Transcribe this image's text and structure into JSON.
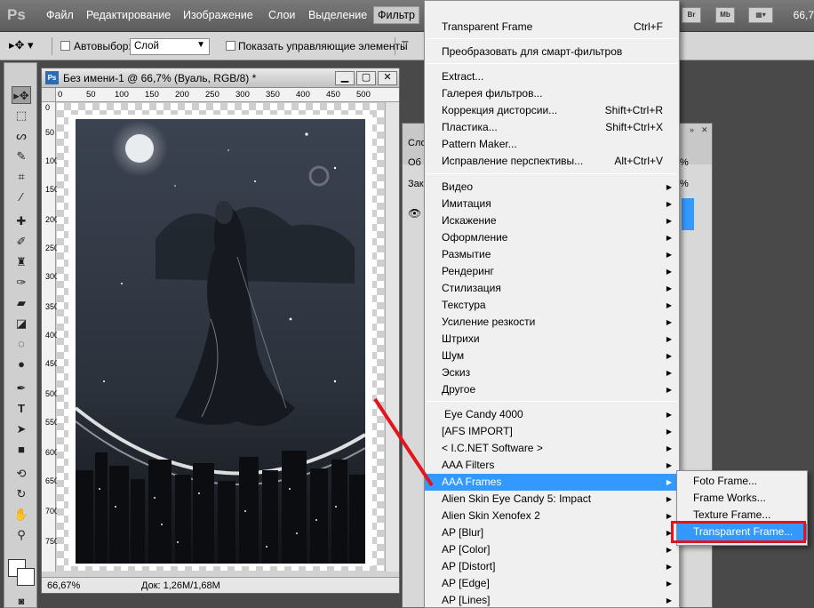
{
  "app": {
    "logo": "Ps",
    "zoom_top": "66,7"
  },
  "menubar": {
    "items": [
      "Файл",
      "Редактирование",
      "Изображение",
      "Слои",
      "Выделение",
      "Фильтр"
    ],
    "right_icons": [
      "Br",
      "Mb"
    ]
  },
  "options": {
    "autoselect_label": "Автовыбор:",
    "layer_value": "Слой",
    "show_controls_label": "Показать управляющие элементы"
  },
  "document": {
    "title": "Без имени-1 @ 66,7% (Вуаль, RGB/8) *",
    "ruler_h": [
      "0",
      "50",
      "100",
      "150",
      "200",
      "250",
      "300",
      "350",
      "400",
      "450",
      "500"
    ],
    "ruler_v": [
      "0",
      "50",
      "100",
      "150",
      "200",
      "250",
      "300",
      "350",
      "400",
      "450",
      "500",
      "550",
      "600",
      "650",
      "700",
      "750"
    ],
    "status_zoom": "66,67%",
    "status_doc": "Док: 1,26M/1,68M"
  },
  "layers_panel": {
    "tab_fragment": "Сло",
    "row2_fragment": "Об",
    "row3_fragment": "Зак",
    "pct1": "%",
    "pct2": "%"
  },
  "filter_menu": {
    "last_filter": "Transparent Frame",
    "last_filter_shortcut": "Ctrl+F",
    "convert_smart": "Преобразовать для смарт-фильтров",
    "group1": [
      {
        "label": "Extract...",
        "shortcut": ""
      },
      {
        "label": "Галерея фильтров...",
        "shortcut": ""
      },
      {
        "label": "Коррекция дисторсии...",
        "shortcut": "Shift+Ctrl+R"
      },
      {
        "label": "Пластика...",
        "shortcut": "Shift+Ctrl+X"
      },
      {
        "label": "Pattern Maker...",
        "shortcut": ""
      },
      {
        "label": "Исправление перспективы...",
        "shortcut": "Alt+Ctrl+V"
      }
    ],
    "group2": [
      "Видео",
      "Имитация",
      "Искажение",
      "Оформление",
      "Размытие",
      "Рендеринг",
      "Стилизация",
      "Текстура",
      "Усиление резкости",
      "Штрихи",
      "Шум",
      "Эскиз",
      "Другое"
    ],
    "group3": [
      "Eye Candy 4000",
      "[AFS IMPORT]",
      "< I.C.NET Software >",
      "AAA Filters",
      "AAA Frames",
      "Alien Skin Eye Candy 5: Impact",
      "Alien Skin Xenofex 2",
      "AP [Blur]",
      "AP [Color]",
      "AP [Distort]",
      "AP [Edge]",
      "AP [Lines]"
    ],
    "highlighted": "AAA Frames"
  },
  "submenu": {
    "items": [
      "Foto Frame...",
      "Frame Works...",
      "Texture Frame...",
      "Transparent Frame..."
    ],
    "highlighted": "Transparent Frame..."
  },
  "colors": {
    "highlight": "#3399ff",
    "annotation_red": "#e3141b"
  }
}
